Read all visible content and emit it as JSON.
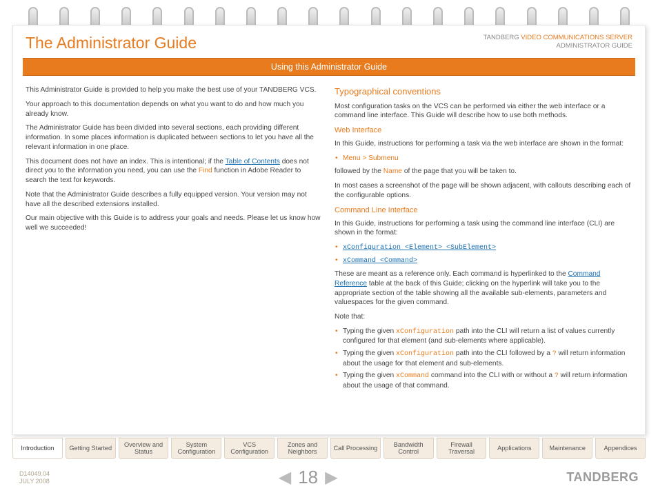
{
  "header": {
    "title": "The Administrator Guide",
    "right_line1_prefix": "TANDBERG ",
    "right_line1_hl": "VIDEO COMMUNICATIONS SERVER",
    "right_line2": "ADMINISTRATOR GUIDE"
  },
  "banner": "Using this Administrator Guide",
  "left": {
    "p1": "This Administrator Guide is provided to help you make the best use of your TANDBERG VCS.",
    "p2": "Your approach to this documentation depends on what you want to do and how much you already know.",
    "p3": "The Administrator Guide has been divided into several sections, each providing different information. In some places information is duplicated between sections to let you have all the relevant information in one place.",
    "p4a": "This document does not have an index.  This is intentional; if the ",
    "toc_link": "Table of Contents",
    "p4b": " does not direct you to the information you need, you can use the ",
    "find_link": "Find",
    "p4c": " function in Adobe Reader to search the text for keywords.",
    "p5": "Note that the Administrator Guide describes a fully equipped version. Your version may not have all the described extensions installed.",
    "p6": "Our main objective with this Guide is to address your goals and needs. Please let us know how well we succeeded!"
  },
  "right": {
    "h1": "Typographical conventions",
    "p1": "Most configuration tasks on the VCS can be performed via either the web interface or a command line interface.  This Guide will describe how to use both methods.",
    "web_h": "Web Interface",
    "web_p1": "In this Guide, instructions for performing a task via the web interface are shown in the format:",
    "web_bullet": "Menu > Submenu",
    "web_p2a": "followed by the ",
    "web_name": "Name",
    "web_p2b": " of the page that you will be taken to.",
    "web_p3": "In most cases a screenshot of the page will be shown adjacent, with callouts describing each of the configurable options.",
    "cli_h": "Command Line Interface",
    "cli_p1": "In this Guide, instructions for performing a task using the command line interface (CLI) are shown in the format:",
    "cli_b1": "xConfiguration <Element> <SubElement>",
    "cli_b2": "xCommand <Command>",
    "cli_p2a": "These are meant as a reference only. Each command is hyperlinked to the ",
    "cli_cmdref": "Command Reference",
    "cli_p2b": " table at the back of this Guide; clicking on the hyperlink will take you to the appropriate section of the table showing all the available sub-elements, parameters and valuespaces for the given command.",
    "cli_note": "Note that:",
    "cli_li1a": "Typing the given ",
    "cli_li1_code": "xConfiguration",
    "cli_li1b": " path into the CLI will return a list of values currently configured for that element (and sub-elements where applicable).",
    "cli_li2a": "Typing the given ",
    "cli_li2_code": "xConfiguration",
    "cli_li2b": " path into the CLI followed by a ",
    "cli_li2_q": "?",
    "cli_li2c": " will return information about the usage for that element and sub-elements.",
    "cli_li3a": "Typing the given ",
    "cli_li3_code": "xCommand",
    "cli_li3b": " command into the CLI with or without a ",
    "cli_li3_q": "?",
    "cli_li3c": " will return information about the usage of that command."
  },
  "tabs": [
    "Introduction",
    "Getting Started",
    "Overview and Status",
    "System Configuration",
    "VCS Configuration",
    "Zones and Neighbors",
    "Call Processing",
    "Bandwidth Control",
    "Firewall Traversal",
    "Applications",
    "Maintenance",
    "Appendices"
  ],
  "active_tab": 0,
  "footer": {
    "doc_id": "D14049.04",
    "doc_date": "JULY 2008",
    "page": "18",
    "brand": "TANDBERG"
  }
}
